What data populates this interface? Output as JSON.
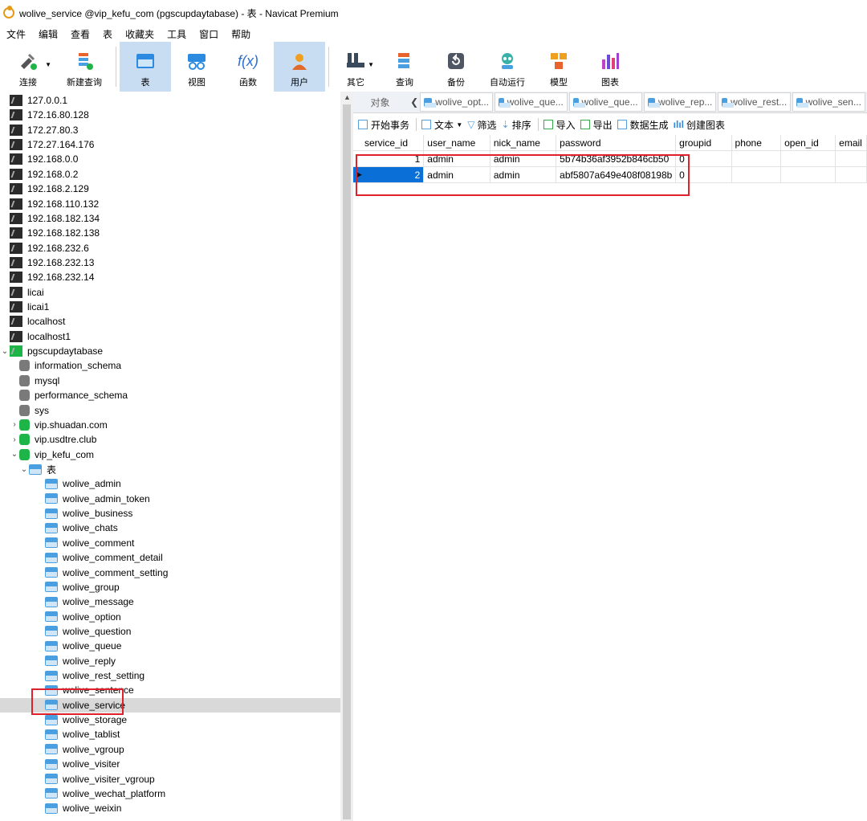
{
  "window": {
    "title": "wolive_service @vip_kefu_com (pgscupdaytabase) - 表 - Navicat Premium"
  },
  "menu": [
    "文件",
    "编辑",
    "查看",
    "表",
    "收藏夹",
    "工具",
    "窗口",
    "帮助"
  ],
  "toolbar": {
    "left": [
      {
        "label": "连接",
        "icon": "connect-icon"
      },
      {
        "label": "新建查询",
        "icon": "new-query-icon"
      }
    ],
    "main": [
      {
        "label": "表",
        "icon": "table-icon",
        "active": true
      },
      {
        "label": "视图",
        "icon": "view-icon"
      },
      {
        "label": "函数",
        "icon": "function-icon",
        "glyph": "f(x)"
      },
      {
        "label": "用户",
        "icon": "user-icon",
        "active": true
      },
      {
        "label": "其它",
        "icon": "other-icon"
      },
      {
        "label": "查询",
        "icon": "query-icon"
      },
      {
        "label": "备份",
        "icon": "backup-icon"
      },
      {
        "label": "自动运行",
        "icon": "automation-icon"
      },
      {
        "label": "模型",
        "icon": "model-icon"
      },
      {
        "label": "图表",
        "icon": "chart-icon"
      }
    ]
  },
  "connections": [
    "127.0.0.1",
    "172.16.80.128",
    "172.27.80.3",
    "172.27.164.176",
    "192.168.0.0",
    "192.168.0.2",
    "192.168.2.129",
    "192.168.110.132",
    "192.168.182.134",
    "192.168.182.138",
    "192.168.232.6",
    "192.168.232.13",
    "192.168.232.14",
    "licai",
    "licai1",
    "localhost",
    "localhost1"
  ],
  "open_connection": "pgscupdaytabase",
  "databases_plain": [
    "information_schema",
    "mysql",
    "performance_schema",
    "sys"
  ],
  "databases_green": [
    "vip.shuadan.com",
    "vip.usdtre.club"
  ],
  "open_database": "vip_kefu_com",
  "tables_node": "表",
  "tables": [
    "wolive_admin",
    "wolive_admin_token",
    "wolive_business",
    "wolive_chats",
    "wolive_comment",
    "wolive_comment_detail",
    "wolive_comment_setting",
    "wolive_group",
    "wolive_message",
    "wolive_option",
    "wolive_question",
    "wolive_queue",
    "wolive_reply",
    "wolive_rest_setting",
    "wolive_sentence",
    "wolive_service",
    "wolive_storage",
    "wolive_tablist",
    "wolive_vgroup",
    "wolive_visiter",
    "wolive_visiter_vgroup",
    "wolive_wechat_platform",
    "wolive_weixin"
  ],
  "selected_table": "wolive_service",
  "tabs": [
    "对象",
    "wolive_opt...",
    "wolive_que...",
    "wolive_que...",
    "wolive_rep...",
    "wolive_rest...",
    "wolive_sen..."
  ],
  "subtoolbar": {
    "begin": "开始事务",
    "text": "文本",
    "filter": "筛选",
    "sort": "排序",
    "import": "导入",
    "export": "导出",
    "datagen": "数据生成",
    "chart": "创建图表"
  },
  "grid": {
    "columns": [
      "service_id",
      "user_name",
      "nick_name",
      "password",
      "groupid",
      "phone",
      "open_id",
      "email"
    ],
    "rows": [
      [
        "1",
        "admin",
        "admin",
        "5b74b36af3952b846cb50",
        "0",
        "",
        "",
        ""
      ],
      [
        "2",
        "admin",
        "admin",
        "abf5807a649e408f08198b",
        "0",
        "",
        "",
        ""
      ]
    ]
  }
}
